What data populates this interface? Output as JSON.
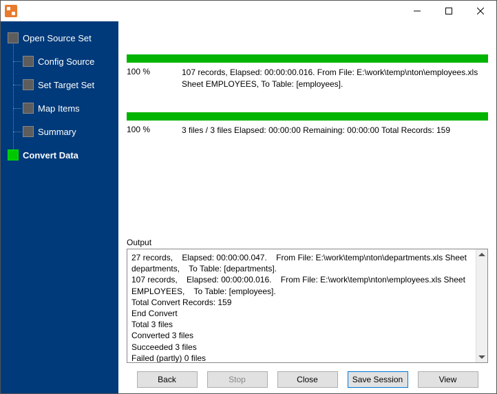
{
  "window": {
    "title": ""
  },
  "nav": {
    "root": "Open Source Set",
    "items": [
      {
        "label": "Config Source"
      },
      {
        "label": "Set Target Set"
      },
      {
        "label": "Map Items"
      },
      {
        "label": "Summary"
      }
    ],
    "final": "Convert Data"
  },
  "task": {
    "percent": "100 %",
    "line1": "107 records,    Elapsed: 00:00:00.016.    From File: E:\\work\\temp\\nton\\employees.xls Sheet EMPLOYEES,    To Table: [employees]."
  },
  "overall": {
    "percent": "100 %",
    "line1": "3 files / 3 files    Elapsed: 00:00:00    Remaining: 00:00:00    Total Records: 159"
  },
  "output": {
    "label": "Output",
    "text": "27 records,    Elapsed: 00:00:00.047.    From File: E:\\work\\temp\\nton\\departments.xls Sheet departments,    To Table: [departments].\n107 records,    Elapsed: 00:00:00.016.    From File: E:\\work\\temp\\nton\\employees.xls Sheet EMPLOYEES,    To Table: [employees].\nTotal Convert Records: 159\nEnd Convert\nTotal 3 files\nConverted 3 files\nSucceeded 3 files\nFailed (partly) 0 files"
  },
  "buttons": {
    "back": "Back",
    "stop": "Stop",
    "close": "Close",
    "save": "Save Session",
    "view": "View"
  },
  "colors": {
    "sidebar": "#003a7a",
    "progress": "#00b400",
    "accent": "#0078d7"
  }
}
